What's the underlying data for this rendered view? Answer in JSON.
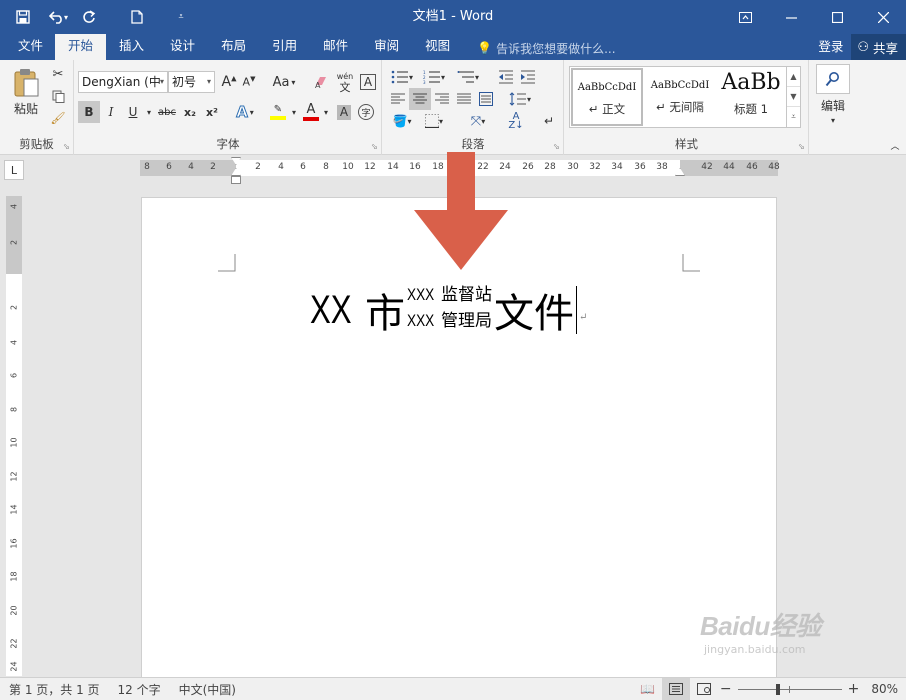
{
  "window": {
    "title": "文档1 - Word",
    "controls": [
      "ribbon-display",
      "minimize",
      "maximize",
      "close"
    ]
  },
  "tabs": [
    "文件",
    "开始",
    "插入",
    "设计",
    "布局",
    "引用",
    "邮件",
    "审阅",
    "视图"
  ],
  "active_tab": "开始",
  "tell_me": "告诉我您想要做什么...",
  "signin": "登录",
  "share": "共享",
  "ribbon": {
    "clipboard": {
      "label": "剪贴板",
      "paste": "粘贴"
    },
    "font": {
      "label": "字体",
      "font_name": "DengXian (中",
      "font_size": "初号",
      "wen": "wén",
      "wen_char": "文",
      "aa": "Aa",
      "a_big": "A",
      "a_small": "A",
      "bold": "B",
      "italic": "I",
      "underline": "U",
      "strike": "abc",
      "sub": "x₂",
      "sup": "x²",
      "highlight_color": "#ffff00",
      "font_color": "#e00000",
      "char_shading": "A",
      "enclose": "字",
      "effects": "A",
      "hl_a": "ab",
      "fc_a": "A"
    },
    "paragraph": {
      "label": "段落"
    },
    "styles": {
      "label": "样式",
      "items": [
        {
          "sample": "AaBbCcDdI",
          "name": "↵ 正文"
        },
        {
          "sample": "AaBbCcDdI",
          "name": "↵ 无间隔"
        },
        {
          "sample": "AaBb",
          "name": "标题 1"
        }
      ]
    },
    "editing": {
      "label": "编辑"
    }
  },
  "ruler": {
    "numbers": [
      "8",
      "6",
      "4",
      "2",
      "2",
      "4",
      "6",
      "8",
      "10",
      "12",
      "14",
      "16",
      "18",
      "20",
      "22",
      "24",
      "26",
      "28",
      "30",
      "32",
      "34",
      "36",
      "38",
      "42",
      "44",
      "46",
      "48"
    ],
    "vertical_numbers": [
      "4",
      "2",
      "2",
      "4",
      "6",
      "8",
      "10",
      "12",
      "14",
      "16",
      "18",
      "20",
      "22",
      "24"
    ]
  },
  "document": {
    "part1": "XX",
    "part2": "市",
    "combo_lines": [
      {
        "latin": "XXX",
        "cjk": "监督站"
      },
      {
        "latin": "XXX",
        "cjk": "管理局"
      }
    ],
    "part3": "文件",
    "para_mark": "↵"
  },
  "accent_color": "#2b579a",
  "arrow_color": "#d9604a",
  "status": {
    "page": "第 1 页，共 1 页",
    "words": "12 个字",
    "language": "中文(中国)",
    "zoom": "80%",
    "zoom_percent": 80
  },
  "watermark": {
    "brand": "Baidu经验",
    "url": "jingyan.baidu.com"
  }
}
